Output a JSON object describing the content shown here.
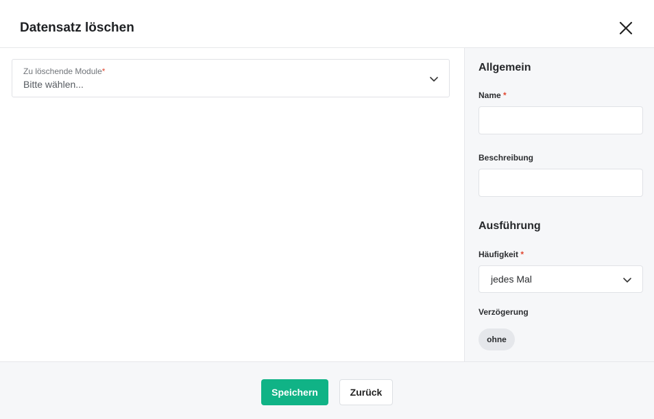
{
  "dialog": {
    "title": "Datensatz löschen",
    "close_icon": "close-icon"
  },
  "main": {
    "modules_select": {
      "label": "Zu löschende Module",
      "required_mark": "*",
      "value": "Bitte wählen...",
      "icon": "chevron-down-icon"
    }
  },
  "sidebar": {
    "general": {
      "title": "Allgemein",
      "name_label": "Name",
      "name_required_mark": "*",
      "name_value": "",
      "description_label": "Beschreibung",
      "description_value": ""
    },
    "execution": {
      "title": "Ausführung",
      "frequency_label": "Häufigkeit",
      "frequency_required_mark": "*",
      "frequency_value": "jedes Mal",
      "delay_label": "Verzögerung",
      "delay_chip": "ohne"
    }
  },
  "footer": {
    "save_label": "Speichern",
    "back_label": "Zurück"
  },
  "colors": {
    "primary": "#10b386",
    "required": "#e0462f",
    "panel_bg": "#f6f7f9"
  }
}
